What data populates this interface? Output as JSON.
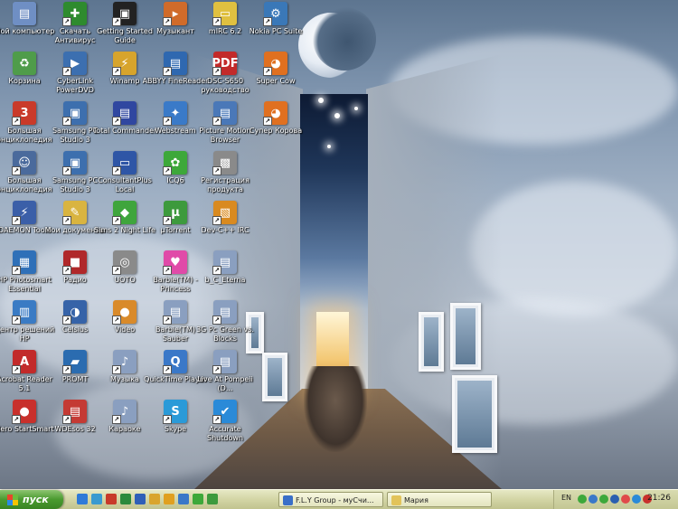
{
  "icons": [
    {
      "label": "Мой компьютер",
      "glyph": "▤",
      "color": "#6f8fc4"
    },
    {
      "label": "Корзина",
      "glyph": "♻",
      "color": "#4f9c4a"
    },
    {
      "label": "Большая энциклопедия",
      "glyph": "3",
      "color": "#c93a2a"
    },
    {
      "label": "Большая энциклопедия",
      "glyph": "☺",
      "color": "#4a6a9c"
    },
    {
      "label": "DAEMON Tools",
      "glyph": "⚡",
      "color": "#3b5fa8"
    },
    {
      "label": "HP Photosmart Essential",
      "glyph": "▦",
      "color": "#2f70b8"
    },
    {
      "label": "Центр решений HP",
      "glyph": "▥",
      "color": "#3a7bc4"
    },
    {
      "label": "Acrobat Reader 5.1",
      "glyph": "A",
      "color": "#c22a2a"
    },
    {
      "label": "Nero StartSmart",
      "glyph": "●",
      "color": "#c8302c"
    },
    {
      "label": "Скачать Антивирус",
      "glyph": "✚",
      "color": "#2e8b2e"
    },
    {
      "label": "CyberLink PowerDVD",
      "glyph": "▶",
      "color": "#3c6fb0"
    },
    {
      "label": "Samsung PC Studio 3",
      "glyph": "▣",
      "color": "#3d6fae"
    },
    {
      "label": "Samsung PC Studio 3",
      "glyph": "▣",
      "color": "#3d6fae"
    },
    {
      "label": "Мои документы",
      "glyph": "✎",
      "color": "#d9b440"
    },
    {
      "label": "Радио",
      "glyph": "■",
      "color": "#b0282a"
    },
    {
      "label": "Celsius",
      "glyph": "◑",
      "color": "#3663a8"
    },
    {
      "label": "PROMT",
      "glyph": "▰",
      "color": "#2b6cb0"
    },
    {
      "label": "WDEsos 32",
      "glyph": "▤",
      "color": "#c43a34"
    },
    {
      "label": "Getting Started Guide",
      "glyph": "▣",
      "color": "#222222"
    },
    {
      "label": "Winamp",
      "glyph": "⚡",
      "color": "#d7a42c"
    },
    {
      "label": "Total Commander",
      "glyph": "▤",
      "color": "#3047a0"
    },
    {
      "label": "ConsultantPlus Local",
      "glyph": "▭",
      "color": "#2f56a6"
    },
    {
      "label": "Sims 2 Night Life",
      "glyph": "◆",
      "color": "#3fa53c"
    },
    {
      "label": "UOTO",
      "glyph": "◎",
      "color": "#8a8a8a"
    },
    {
      "label": "Video",
      "glyph": "●",
      "color": "#d98a2a"
    },
    {
      "label": "Музыка",
      "glyph": "♪",
      "color": "#8a9fc0"
    },
    {
      "label": "Караоке",
      "glyph": "♪",
      "color": "#8a9fc0"
    },
    {
      "label": "Музыкант",
      "glyph": "▸",
      "color": "#d06b2a"
    },
    {
      "label": "ABBYY FineReader",
      "glyph": "▤",
      "color": "#2f68b0"
    },
    {
      "label": "Webstream",
      "glyph": "✦",
      "color": "#3a7ac8"
    },
    {
      "label": "ICQ6",
      "glyph": "✿",
      "color": "#3da83a"
    },
    {
      "label": "µTorrent",
      "glyph": "µ",
      "color": "#3d9a3d"
    },
    {
      "label": "Barbie(TM) - Princess",
      "glyph": "♥",
      "color": "#e04aa8"
    },
    {
      "label": "Barbie(TM) Sauber",
      "glyph": "▤",
      "color": "#8a9fc0"
    },
    {
      "label": "QuickTime Player",
      "glyph": "Q",
      "color": "#3a78c8"
    },
    {
      "label": "Skype",
      "glyph": "S",
      "color": "#2a9ad8"
    },
    {
      "label": "mIRC 6.2",
      "glyph": "▭",
      "color": "#e0c040"
    },
    {
      "label": "DSC-S650 руководство",
      "glyph": "PDF",
      "color": "#c22a2a"
    },
    {
      "label": "Picture Motion Browser",
      "glyph": "▤",
      "color": "#4a78b8"
    },
    {
      "label": "Регистрация продукта",
      "glyph": "▩",
      "color": "#8a8a8a"
    },
    {
      "label": "Dev-C++ IRC",
      "glyph": "▧",
      "color": "#d98a20"
    },
    {
      "label": "b_C_Eterna",
      "glyph": "▤",
      "color": "#8a9fc0"
    },
    {
      "label": "3G Pc Green vs. Blocks",
      "glyph": "▤",
      "color": "#8a9fc0"
    },
    {
      "label": "Live At Pompeii (D...",
      "glyph": "▤",
      "color": "#8a9fc0"
    },
    {
      "label": "Accurate Shutdown",
      "glyph": "✔",
      "color": "#2a8ad8"
    },
    {
      "label": "Nokia PC Suite",
      "glyph": "⚙",
      "color": "#3a78b8"
    },
    {
      "label": "Super Cow",
      "glyph": "◕",
      "color": "#e07020"
    },
    {
      "label": "Супер Корова",
      "glyph": "◕",
      "color": "#e07020"
    }
  ],
  "taskbar": {
    "start_label": "пуск",
    "tasks": [
      {
        "label": "F.L.Y Group - муСчи...",
        "color": "#3a6fc8"
      },
      {
        "label": "Мария",
        "color": "#e2c35a"
      }
    ],
    "quicklaunch": [
      {
        "icon": "ie-icon",
        "color": "#2f7ad8"
      },
      {
        "icon": "media-icon",
        "color": "#3a9ad0"
      },
      {
        "icon": "acrobat-icon",
        "color": "#c83a2a"
      },
      {
        "icon": "excel-icon",
        "color": "#2c8a3c"
      },
      {
        "icon": "word-icon",
        "color": "#2f5fb8"
      },
      {
        "icon": "folder-icon",
        "color": "#d9a42c"
      },
      {
        "icon": "search-icon",
        "color": "#e0a020"
      },
      {
        "icon": "globe-icon",
        "color": "#3a78c8"
      },
      {
        "icon": "icq-icon",
        "color": "#3da83a"
      },
      {
        "icon": "torrent-icon",
        "color": "#3d9a3d"
      }
    ],
    "tray": {
      "language": "EN",
      "clock": "21:26",
      "icons": [
        {
          "icon": "antivirus-icon",
          "color": "#3da83a"
        },
        {
          "icon": "network-icon",
          "color": "#3a78c8"
        },
        {
          "icon": "icq-tray-icon",
          "color": "#3da83a"
        },
        {
          "icon": "volume-icon",
          "color": "#2a5fb0"
        },
        {
          "icon": "flower-icon",
          "color": "#e04a4a"
        },
        {
          "icon": "monitor-icon",
          "color": "#2a8ad8"
        },
        {
          "icon": "shield-icon",
          "color": "#c8302c"
        }
      ]
    }
  }
}
